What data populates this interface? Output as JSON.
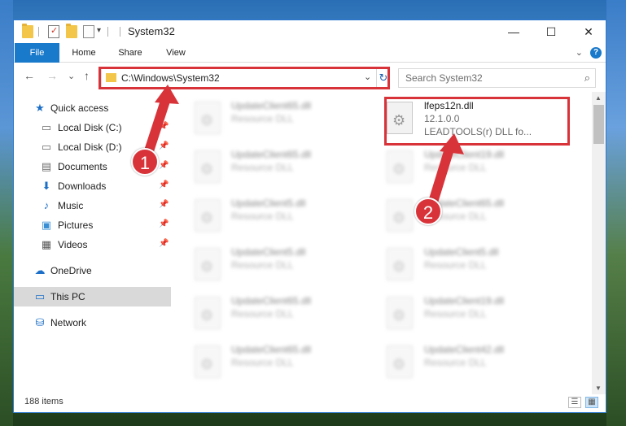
{
  "window": {
    "title": "System32",
    "minimize": "—",
    "maximize": "☐",
    "close": "✕"
  },
  "ribbon": {
    "tabs": [
      "File",
      "Home",
      "Share",
      "View"
    ],
    "help": "?"
  },
  "nav": {
    "back": "←",
    "forward": "→",
    "recent": "⌄",
    "up": "↑",
    "address": "C:\\Windows\\System32",
    "refresh": "↻",
    "search_placeholder": "Search System32"
  },
  "sidebar": {
    "items": [
      {
        "label": "Quick access",
        "icon": "star-icon",
        "pinned": false
      },
      {
        "label": "Local Disk (C:)",
        "icon": "drive-icon",
        "pinned": true
      },
      {
        "label": "Local Disk (D:)",
        "icon": "drive-icon",
        "pinned": true
      },
      {
        "label": "Documents",
        "icon": "document-icon",
        "pinned": true
      },
      {
        "label": "Downloads",
        "icon": "download-icon",
        "pinned": true
      },
      {
        "label": "Music",
        "icon": "music-icon",
        "pinned": true
      },
      {
        "label": "Pictures",
        "icon": "pictures-icon",
        "pinned": true
      },
      {
        "label": "Videos",
        "icon": "videos-icon",
        "pinned": true
      },
      {
        "label": "OneDrive",
        "icon": "cloud-icon",
        "pinned": false
      },
      {
        "label": "This PC",
        "icon": "computer-icon",
        "pinned": false,
        "selected": true
      },
      {
        "label": "Network",
        "icon": "network-icon",
        "pinned": false
      }
    ]
  },
  "files": {
    "left": [
      {
        "name": "UpdateClient65.dll",
        "type": "Resource DLL"
      },
      {
        "name": "UpdateClient65.dll",
        "type": "Resource DLL"
      },
      {
        "name": "UpdateClient5.dll",
        "type": "Resource DLL"
      },
      {
        "name": "UpdateClient5.dll",
        "type": "Resource DLL"
      },
      {
        "name": "UpdateClient65.dll",
        "type": "Resource DLL"
      },
      {
        "name": "UpdateClient65.dll",
        "type": "Resource DLL"
      }
    ],
    "right": [
      {
        "name": "lfeps12n.dll",
        "type": "12.1.0.0",
        "desc": "LEADTOOLS(r) DLL fo...",
        "highlighted": true
      },
      {
        "name": "UpdateClient19.dll",
        "type": "Resource DLL"
      },
      {
        "name": "UpdateClient65.dll",
        "type": "Resource DLL"
      },
      {
        "name": "UpdateClient5.dll",
        "type": "Resource DLL"
      },
      {
        "name": "UpdateClient19.dll",
        "type": "Resource DLL"
      },
      {
        "name": "UpdateClient42.dll",
        "type": "Resource DLL"
      }
    ]
  },
  "status": {
    "item_count": "188 items"
  },
  "annotations": {
    "badge1": "1",
    "badge2": "2",
    "color": "#d9333a"
  }
}
